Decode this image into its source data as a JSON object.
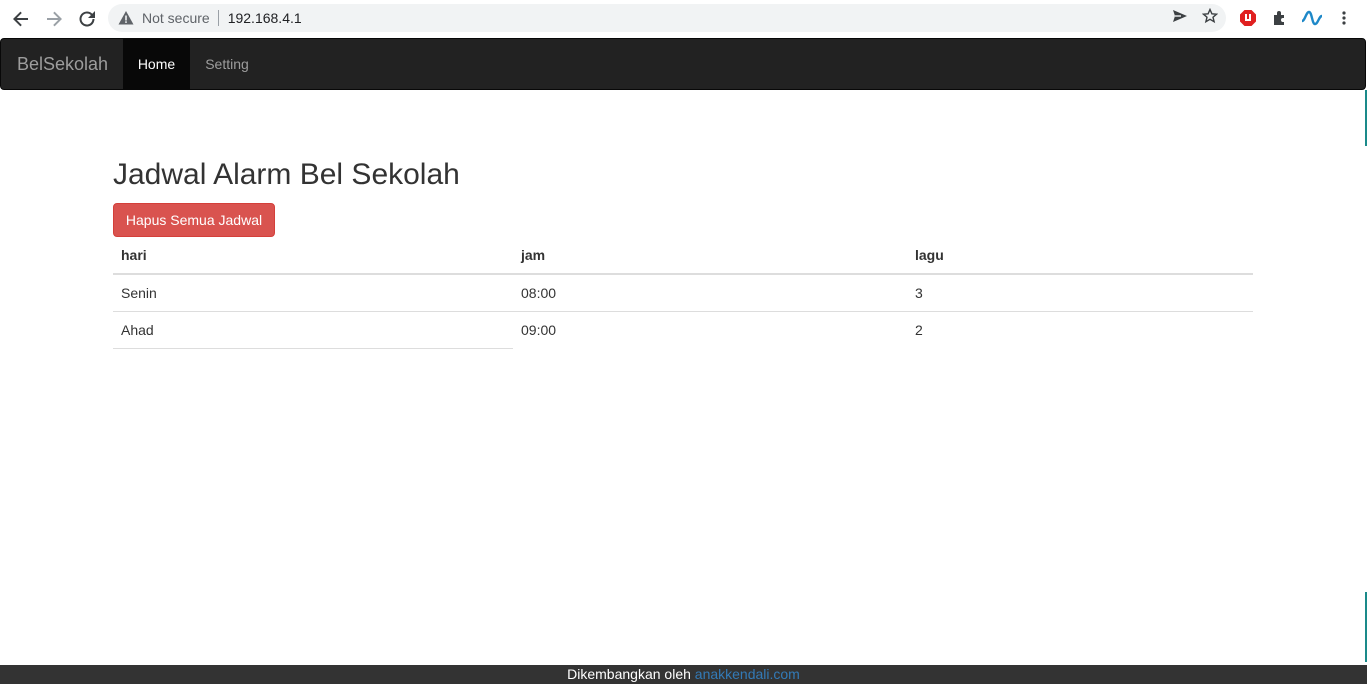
{
  "browser": {
    "security_label": "Not secure",
    "url": "192.168.4.1",
    "icons": [
      "back-arrow-icon",
      "forward-arrow-icon",
      "reload-icon",
      "warning-icon",
      "send-icon",
      "star-icon",
      "adblock-icon",
      "extensions-icon",
      "extension-wave-icon",
      "kebab-menu-icon"
    ]
  },
  "navbar": {
    "brand": "BelSekolah",
    "items": [
      {
        "label": "Home",
        "active": true
      },
      {
        "label": "Setting",
        "active": false
      }
    ]
  },
  "main": {
    "title": "Jadwal Alarm Bel Sekolah",
    "delete_all_button": "Hapus Semua Jadwal",
    "table": {
      "headers": [
        "hari",
        "jam",
        "lagu"
      ],
      "rows": [
        [
          "Senin",
          "08:00",
          "3"
        ],
        [
          "Ahad",
          "09:00",
          "2"
        ]
      ]
    }
  },
  "footer": {
    "text": "Dikembangkan oleh",
    "link_text": "anakkendali.com"
  },
  "colors": {
    "navbar_bg": "#222222",
    "active_tab_bg": "#080808",
    "danger": "#d9534f",
    "footer_bg": "#333333",
    "link": "#337ab7"
  }
}
